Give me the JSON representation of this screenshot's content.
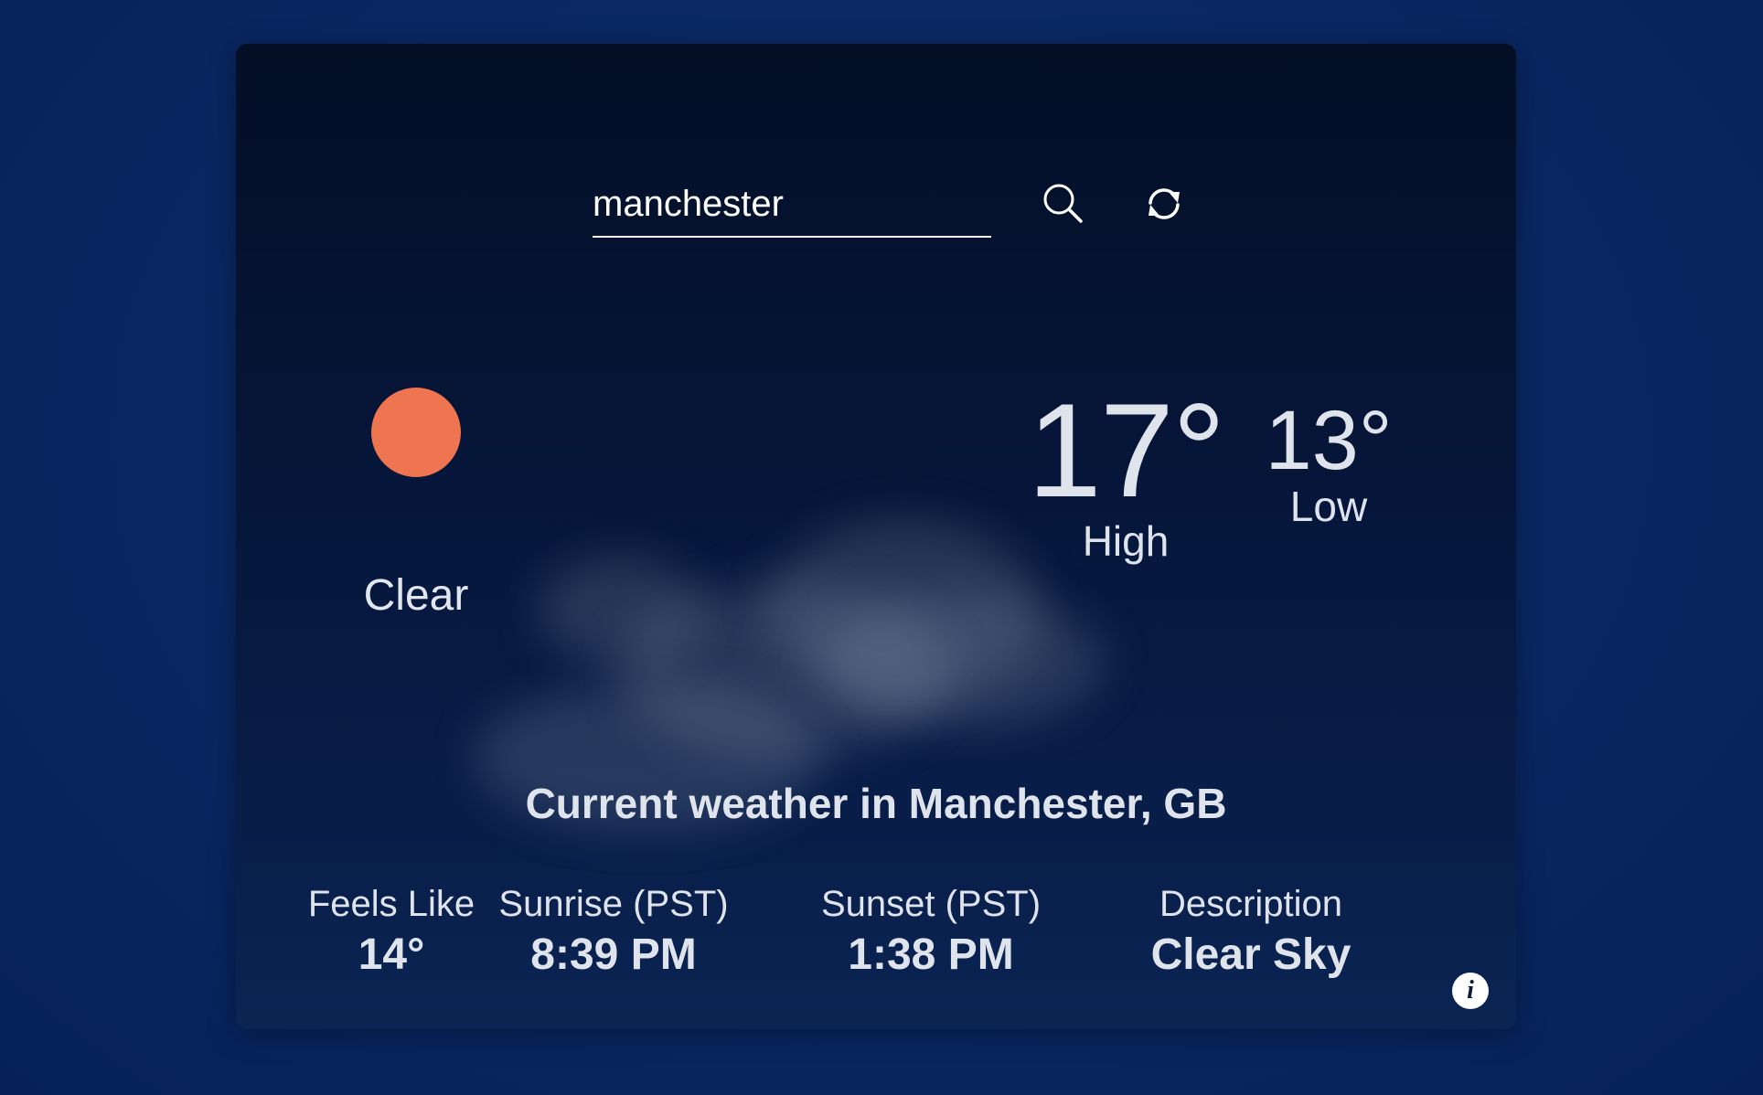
{
  "search": {
    "value": "manchester",
    "placeholder": ""
  },
  "icons": {
    "search": "search-icon",
    "refresh": "refresh-icon",
    "weather": "sun-icon",
    "info": "info-icon"
  },
  "current": {
    "condition": "Clear",
    "high": "17°",
    "high_label": "High",
    "low": "13°",
    "low_label": "Low"
  },
  "location_title": "Current weather in Manchester, GB",
  "stats": [
    {
      "label": "Feels Like",
      "value": "14°"
    },
    {
      "label": "Sunrise (PST)",
      "value": "8:39 PM"
    },
    {
      "label": "Sunset (PST)",
      "value": "1:38 PM"
    },
    {
      "label": "Description",
      "value": "Clear Sky"
    }
  ],
  "info_button": {
    "label": "i"
  },
  "colors": {
    "background": "#0a2a66",
    "card": "#06163a",
    "sun": "#ee7550",
    "text": "#dfe3eb"
  }
}
